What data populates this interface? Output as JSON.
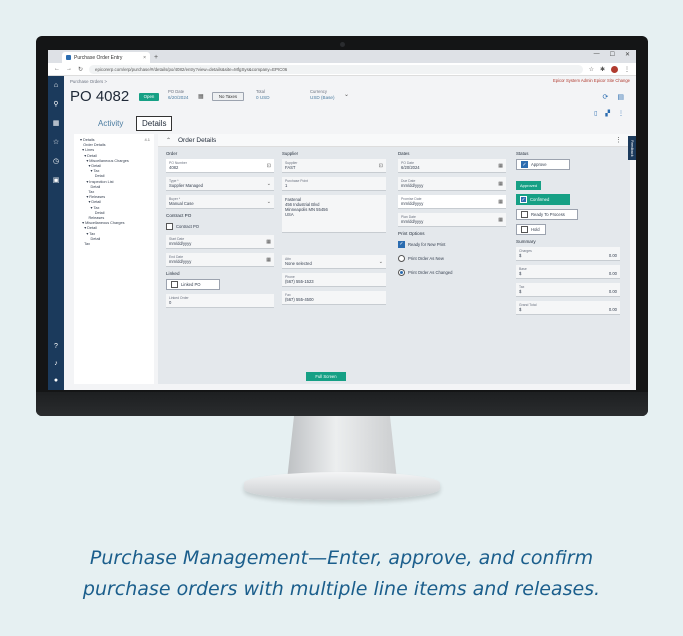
{
  "browser": {
    "tab_title": "Purchase Order Entry",
    "tab_close": "×",
    "new_tab": "+",
    "url": "epicorerp.com/erp/purchase/#/details/po/4082/entry?view=details&site=MfgSys&company=EPIC06",
    "window_controls": [
      "—",
      "☐",
      "✕"
    ]
  },
  "app": {
    "breadcrumb": "Purchase Orders  >",
    "top_right": "Epicor System Admin  Epicor Site  Change",
    "po_title": "PO 4082",
    "status_badge": "Open",
    "header_fields": [
      {
        "label": "PO Date",
        "value": "6/20/2024"
      },
      {
        "label": "Total",
        "value": "0   USD"
      },
      {
        "label": "Currency",
        "value": "USD (Base)"
      }
    ],
    "no_taxes_label": "No Taxes",
    "tabs": {
      "activity": "Activity",
      "details": "Details"
    }
  },
  "tree": {
    "count": "4.1",
    "items": [
      "▾ Details",
      "   Order Details",
      "  ▾ Lines",
      "    ▾ Detail",
      "      ▾ Miscellaneous Charges",
      "        ▾ Detail",
      "          ▾ Tax",
      "              Detail",
      "      ▾ Inspection List",
      "          Detail",
      "        Tax",
      "      ▾ Releases",
      "        ▾ Detail",
      "          ▾ Tax",
      "              Detail",
      "        Releases",
      "  ▾ Miscellaneous Charges",
      "    ▾ Detail",
      "      ▾ Tax",
      "          Detail",
      "    Tax"
    ]
  },
  "panel": {
    "title": "Order Details",
    "feedback": "Feedback",
    "order": {
      "heading": "Order",
      "fields": [
        {
          "label": "PO Number",
          "value": "4082"
        },
        {
          "label": "Type *",
          "value": "Supplier Managed"
        },
        {
          "label": "Buyer *",
          "value": "Manual Case"
        }
      ],
      "contract_heading": "Contract PO",
      "contract_check": "Contract PO",
      "date_fields": [
        {
          "label": "Start Date",
          "value": "mm/dd/yyyy"
        },
        {
          "label": "End Date",
          "value": "mm/dd/yyyy"
        }
      ],
      "linked_heading": "Linked",
      "linked_check": "Linked PO",
      "linked_field": {
        "label": "Linked Order",
        "value": "0"
      }
    },
    "supplier": {
      "heading": "Supplier",
      "fields": [
        {
          "label": "Supplier",
          "value": "FAST"
        },
        {
          "label": "Purchase Point",
          "value": "1"
        }
      ],
      "address": [
        "Fastenal",
        "456 Industrial Blvd",
        "Minneapolis MN 55456",
        "USA"
      ],
      "lower_fields": [
        {
          "label": "Attn",
          "value": "None selected"
        },
        {
          "label": "Phone",
          "value": "(567) 555-1523"
        },
        {
          "label": "Fax",
          "value": "(567) 555-4500"
        }
      ]
    },
    "dates": {
      "heading": "Dates",
      "fields": [
        {
          "label": "PO Date",
          "value": "6/20/2024"
        },
        {
          "label": "Due Date",
          "value": "mm/dd/yyyy"
        },
        {
          "label": "Promise Date",
          "value": "mm/dd/yyyy"
        },
        {
          "label": "Plan Date",
          "value": "mm/dd/yyyy"
        }
      ],
      "print_heading": "Print Options",
      "print_check": "Ready for New Print",
      "radios": [
        {
          "label": "Print Order As New",
          "checked": false
        },
        {
          "label": "Print Order As Changed",
          "checked": true
        }
      ]
    },
    "status": {
      "heading": "Status",
      "approve": "Approve",
      "approved_pill": "Approved",
      "confirmed": "Confirmed",
      "ready": "Ready To Process",
      "hold": "Hold",
      "summary_heading": "Summary",
      "summary": [
        {
          "label": "Charges",
          "currency": "$",
          "value": "0.00"
        },
        {
          "label": "Base",
          "currency": "$",
          "value": "0.00"
        },
        {
          "label": "Tax",
          "currency": "$",
          "value": "0.00"
        },
        {
          "label": "Grand Total",
          "currency": "$",
          "value": "0.00"
        }
      ]
    }
  },
  "fullscreen_label": "Full Screen",
  "caption": {
    "line1": "Purchase Management—Enter, approve, and confirm",
    "line2": "purchase orders with multiple line items and releases."
  }
}
